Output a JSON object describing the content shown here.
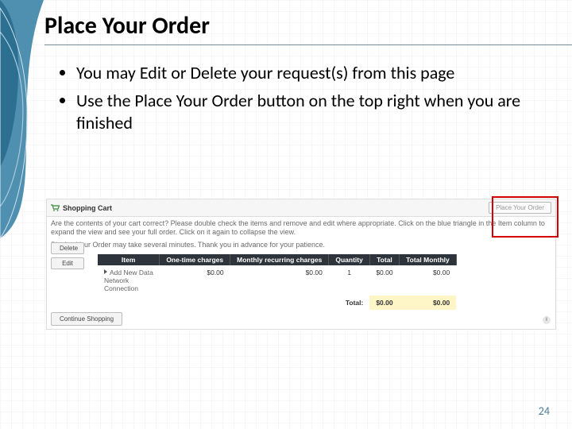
{
  "title": "Place Your Order",
  "bullets": [
    "You may Edit or Delete your request(s) from this page",
    "Use the Place Your Order button on the top right when you are finished"
  ],
  "cart": {
    "header_title": "Shopping Cart",
    "place_order_label": "Place Your Order",
    "instructions_1": "Are the contents of your cart correct? Please double check the items and remove and edit where appropriate. Click on the blue triangle in the Item column to expand the view and see your full order. Click on it again to collapse the view.",
    "instructions_2": "Placing Your Order may take several minutes. Thank you in advance for your patience.",
    "columns": {
      "item": "Item",
      "one_time": "One-time charges",
      "monthly": "Monthly recurring charges",
      "quantity": "Quantity",
      "total": "Total",
      "total_monthly": "Total Monthly"
    },
    "row": {
      "item_line1": "Add New Data",
      "item_line2": "Network",
      "item_line3": "Connection",
      "one_time": "$0.00",
      "monthly": "$0.00",
      "quantity": "1",
      "total": "$0.00",
      "total_monthly": "$0.00"
    },
    "totals": {
      "label": "Total:",
      "total": "$0.00",
      "total_monthly": "$0.00"
    },
    "side_buttons": {
      "delete": "Delete",
      "edit": "Edit"
    },
    "continue_label": "Continue Shopping",
    "info_glyph": "i"
  },
  "page_number": "24"
}
